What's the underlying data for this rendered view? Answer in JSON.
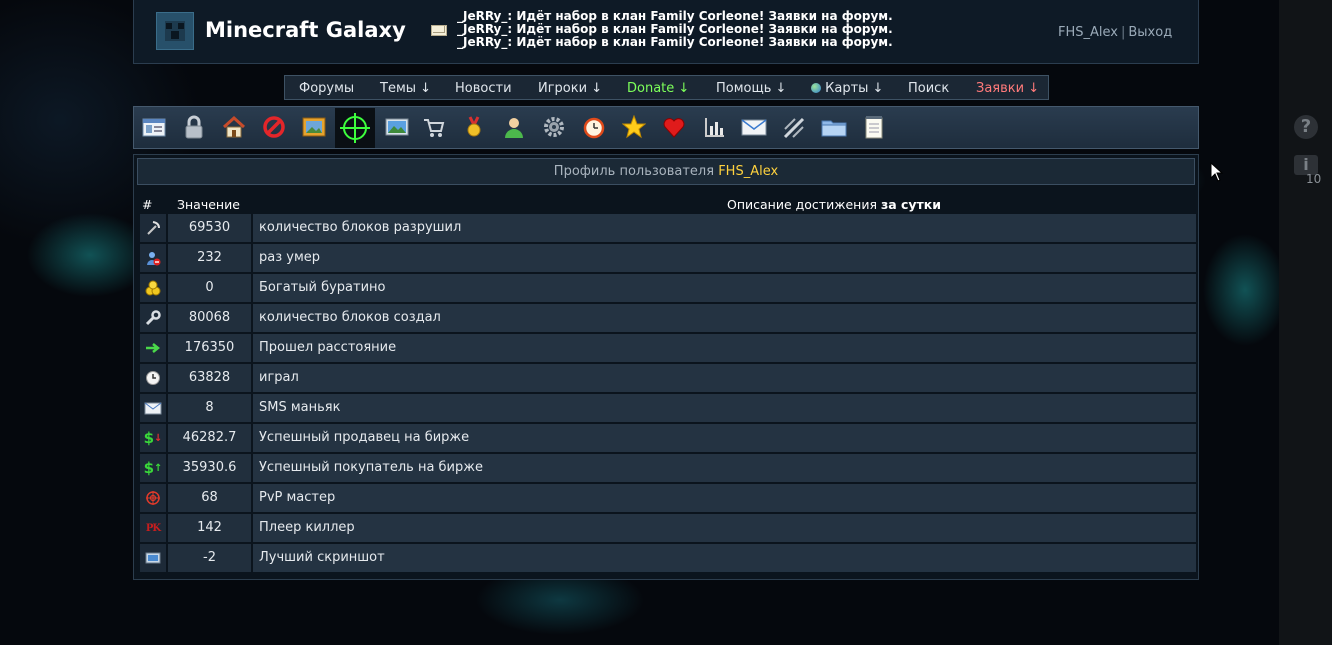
{
  "site": {
    "title": "Minecraft Galaxy"
  },
  "news": [
    "_JeRRy_: Идёт набор в клан Family Corleone! Заявки на форум.",
    "_JeRRy_: Идёт набор в клан Family Corleone! Заявки на форум.",
    "_JeRRy_: Идёт набор в клан Family Corleone! Заявки на форум."
  ],
  "user": {
    "name": "FHS_Alex",
    "separator": "|",
    "logout": "Выход"
  },
  "nav": [
    {
      "label": "Форумы"
    },
    {
      "label": "Темы ↓"
    },
    {
      "label": "Новости"
    },
    {
      "label": "Игроки ↓"
    },
    {
      "label": "Donate ↓"
    },
    {
      "label": "Помощь ↓"
    },
    {
      "label": "Карты ↓"
    },
    {
      "label": "Поиск"
    },
    {
      "label": "Заявки ↓"
    }
  ],
  "toolbar_icons": [
    "profile-card-icon",
    "lock-icon",
    "home-icon",
    "ban-icon",
    "picture-frame-icon",
    "crosshair-icon",
    "landscape-icon",
    "cart-icon",
    "medal-icon",
    "user-icon",
    "gear-icon",
    "alarm-clock-icon",
    "star-icon",
    "heart-icon",
    "bar-chart-icon",
    "envelope-icon",
    "checklist-icon",
    "folder-icon",
    "notepad-icon"
  ],
  "profile": {
    "prefix": "Профиль пользователя",
    "username": "FHS_Alex"
  },
  "table": {
    "headers": {
      "num": "#",
      "value": "Значение",
      "desc": "Описание достижения",
      "period": "за сутки"
    },
    "rows": [
      {
        "icon": "pickaxe-icon",
        "value": "69530",
        "desc": "количество блоков разрушил"
      },
      {
        "icon": "user-remove-icon",
        "value": "232",
        "desc": "раз умер"
      },
      {
        "icon": "gold-coins-icon",
        "value": "0",
        "desc": "Богатый буратино"
      },
      {
        "icon": "wrench-icon",
        "value": "80068",
        "desc": "количество блоков создал"
      },
      {
        "icon": "arrow-right-icon",
        "value": "176350",
        "desc": "Прошел расстояние"
      },
      {
        "icon": "clock-icon",
        "value": "63828",
        "desc": "играл"
      },
      {
        "icon": "envelope-icon",
        "value": "8",
        "desc": "SMS маньяк"
      },
      {
        "icon": "dollar-down-icon",
        "value": "46282.7",
        "desc": "Успешный продавец на бирже"
      },
      {
        "icon": "dollar-up-icon",
        "value": "35930.6",
        "desc": "Успешный покупатель на бирже"
      },
      {
        "icon": "target-icon",
        "value": "68",
        "desc": "PvP мастер"
      },
      {
        "icon": "pk-icon",
        "value": "142",
        "desc": "Плеер киллер"
      },
      {
        "icon": "screenshot-icon",
        "value": "-2",
        "desc": "Лучший скриншот"
      }
    ]
  },
  "sidebar": {
    "help": "?",
    "info": "i",
    "count": "10"
  },
  "colors": {
    "accent_name": "#ffd23e",
    "donate": "#7dff5a",
    "zayavki": "#ff7a7a"
  }
}
